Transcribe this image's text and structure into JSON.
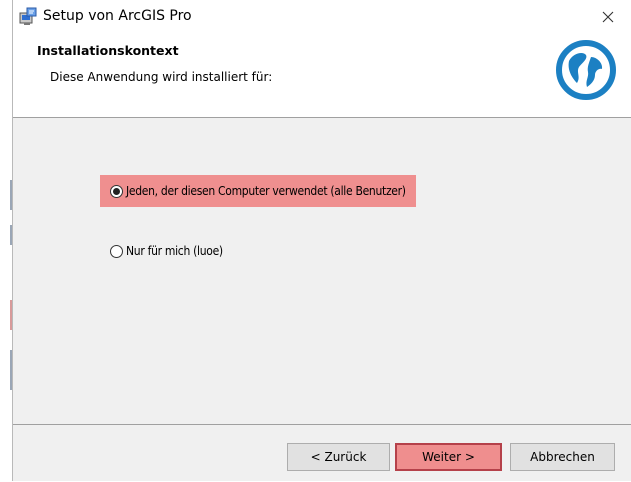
{
  "window": {
    "title": "Setup von ArcGIS Pro"
  },
  "header": {
    "title": "Installationskontext",
    "subtitle": "Diese Anwendung wird installiert für:"
  },
  "options": [
    {
      "label": "Jeden, der diesen Computer verwendet (alle Benutzer)",
      "selected": true
    },
    {
      "label": "Nur für mich (luoe)",
      "selected": false
    }
  ],
  "buttons": {
    "back": "< Zurück",
    "next": "Weiter >",
    "cancel": "Abbrechen"
  },
  "colors": {
    "highlight": "#ef8f8f",
    "globe": "#1c80c3",
    "primary_border": "#b5414a"
  },
  "icons": {
    "app": "setup-installer-icon",
    "close": "close-icon",
    "brand": "arcgis-globe-icon"
  }
}
